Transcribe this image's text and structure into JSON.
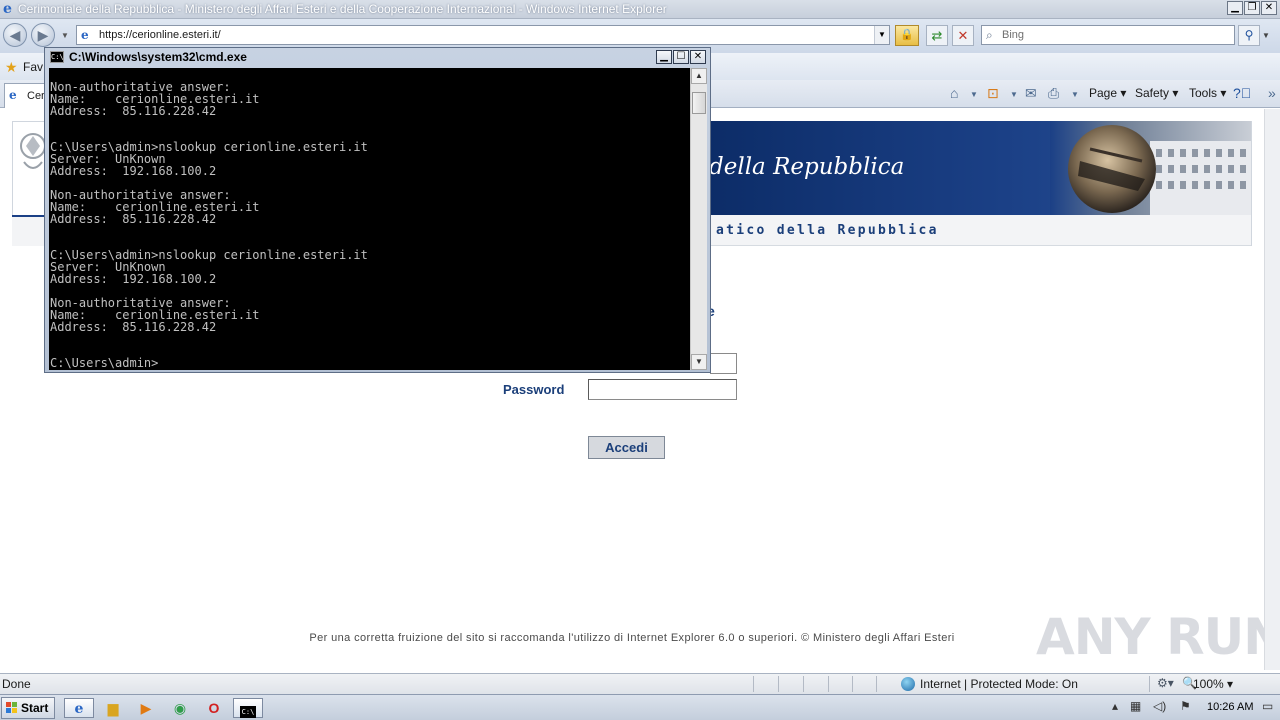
{
  "browser": {
    "title": "Cerimoniale della Repubblica - Ministero degli Affari Esteri e della Cooperazione Internazional - Windows Internet Explorer",
    "url": "https://cerionline.esteri.it/",
    "search_placeholder": "Bing",
    "favorites_label": "Fav",
    "tab_label": "Cer",
    "commands": {
      "page": "Page",
      "safety": "Safety",
      "tools": "Tools"
    }
  },
  "page": {
    "banner_title": "della Repubblica",
    "subheader": "atico della Repubblica",
    "partial_heading": "e",
    "password_label": "Password",
    "submit_label": "Accedi",
    "footer_note": "Per una corretta fruizione del sito si raccomanda l'utilizzo di Internet Explorer 6.0 o superiori. © Ministero degli Affari Esteri",
    "watermark": "ANY RUN"
  },
  "cmd": {
    "title": "C:\\Windows\\system32\\cmd.exe",
    "lines": [
      "Non-authoritative answer:",
      "Name:    cerionline.esteri.it",
      "Address:  85.116.228.42",
      "",
      "",
      "C:\\Users\\admin>nslookup cerionline.esteri.it",
      "Server:  UnKnown",
      "Address:  192.168.100.2",
      "",
      "Non-authoritative answer:",
      "Name:    cerionline.esteri.it",
      "Address:  85.116.228.42",
      "",
      "",
      "C:\\Users\\admin>nslookup cerionline.esteri.it",
      "Server:  UnKnown",
      "Address:  192.168.100.2",
      "",
      "Non-authoritative answer:",
      "Name:    cerionline.esteri.it",
      "Address:  85.116.228.42",
      "",
      "",
      "C:\\Users\\admin>"
    ]
  },
  "status": {
    "text": "Done",
    "zone": "Internet | Protected Mode: On",
    "zoom": "100%"
  },
  "taskbar": {
    "start_label": "Start",
    "clock": "10:26 AM"
  },
  "colors": {
    "banner_blue": "#1b4086",
    "label_blue": "#1b3f7a",
    "console_bg": "#000000",
    "console_text": "#c0c0c0"
  }
}
